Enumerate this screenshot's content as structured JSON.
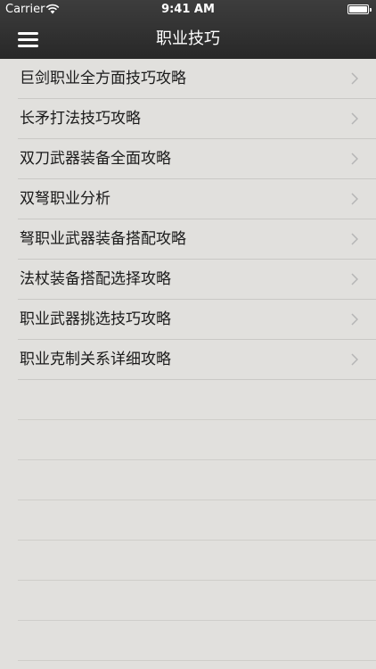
{
  "status_bar": {
    "carrier": "Carrier",
    "time": "9:41 AM"
  },
  "nav": {
    "title": "职业技巧",
    "menu_icon": "hamburger-menu-icon"
  },
  "list": {
    "items": [
      {
        "label": "巨剑职业全方面技巧攻略"
      },
      {
        "label": "长矛打法技巧攻略"
      },
      {
        "label": "双刀武器装备全面攻略"
      },
      {
        "label": "双弩职业分析"
      },
      {
        "label": "弩职业武器装备搭配攻略"
      },
      {
        "label": "法杖装备搭配选择攻略"
      },
      {
        "label": "职业武器挑选技巧攻略"
      },
      {
        "label": "职业克制关系详细攻略"
      }
    ]
  },
  "colors": {
    "navbar": "#2f2f2f",
    "background": "#e1e0dd",
    "text": "#1a1a1a",
    "chevron": "#b5b5b5"
  }
}
